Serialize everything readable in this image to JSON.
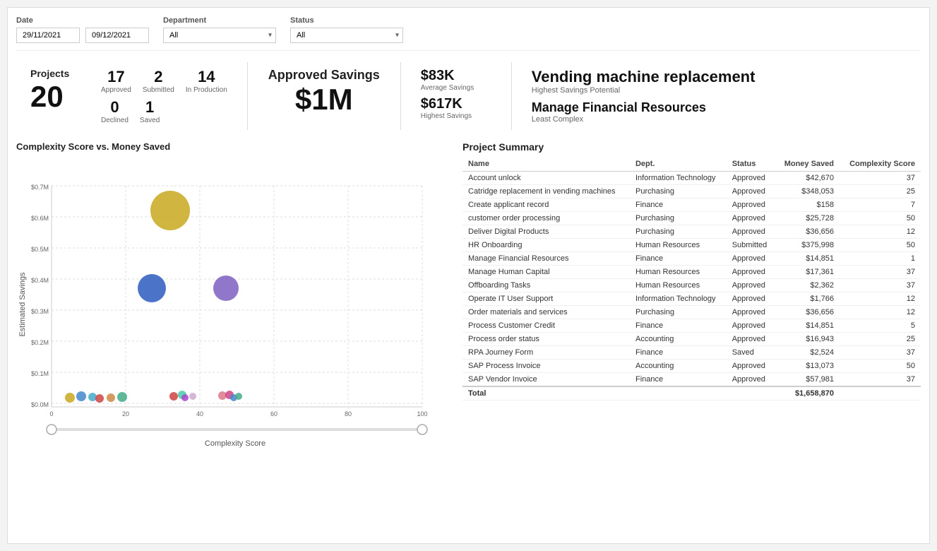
{
  "filters": {
    "date_label": "Date",
    "date_from": "29/11/2021",
    "date_to": "09/12/2021",
    "department_label": "Department",
    "department_value": "All",
    "status_label": "Status",
    "status_value": "All"
  },
  "kpi": {
    "projects_label": "Projects",
    "projects_total": "20",
    "approved_num": "17",
    "approved_label": "Approved",
    "submitted_num": "2",
    "submitted_label": "Submitted",
    "in_production_num": "14",
    "in_production_label": "In Production",
    "declined_num": "0",
    "declined_label": "Declined",
    "saved_num": "1",
    "saved_label": "Saved",
    "approved_savings_label": "Approved Savings",
    "approved_savings_amount": "$1M",
    "avg_savings_value": "$83K",
    "avg_savings_label": "Average Savings",
    "highest_savings_value": "$617K",
    "highest_savings_label": "Highest Savings",
    "vending_title": "Vending machine replacement",
    "vending_sub": "Highest Savings Potential",
    "finance_title": "Manage Financial Resources",
    "finance_sub": "Least Complex"
  },
  "chart": {
    "title": "Complexity Score vs. Money Saved",
    "x_label": "Complexity Score",
    "y_label": "Estimated Savings",
    "bubbles": [
      {
        "x": 32,
        "y": 0.62,
        "r": 28,
        "color": "#c8a820"
      },
      {
        "x": 27,
        "y": 0.37,
        "r": 20,
        "color": "#2b5cbf"
      },
      {
        "x": 47,
        "y": 0.37,
        "r": 18,
        "color": "#7e5fbf"
      },
      {
        "x": 5,
        "y": 0.01,
        "r": 8,
        "color": "#c8a820"
      },
      {
        "x": 8,
        "y": 0.01,
        "r": 8,
        "color": "#4488cc"
      },
      {
        "x": 11,
        "y": 0.01,
        "r": 7,
        "color": "#44aacc"
      },
      {
        "x": 13,
        "y": 0.01,
        "r": 7,
        "color": "#cc4444"
      },
      {
        "x": 16,
        "y": 0.01,
        "r": 6,
        "color": "#cc8844"
      },
      {
        "x": 19,
        "y": 0.01,
        "r": 7,
        "color": "#44aa88"
      },
      {
        "x": 33,
        "y": 0.01,
        "r": 6,
        "color": "#cc4444"
      },
      {
        "x": 35,
        "y": 0.01,
        "r": 5,
        "color": "#aa44cc"
      },
      {
        "x": 36,
        "y": 0.02,
        "r": 7,
        "color": "#44ccaa"
      },
      {
        "x": 38,
        "y": 0.01,
        "r": 5,
        "color": "#ccaacc"
      },
      {
        "x": 46,
        "y": 0.015,
        "r": 6,
        "color": "#dd7788"
      },
      {
        "x": 48,
        "y": 0.02,
        "r": 6,
        "color": "#cc4488"
      }
    ],
    "y_ticks": [
      "$0.0M",
      "$0.1M",
      "$0.2M",
      "$0.3M",
      "$0.4M",
      "$0.5M",
      "$0.6M",
      "$0.7M"
    ],
    "x_ticks": [
      "0",
      "20",
      "40",
      "60",
      "80",
      "100"
    ]
  },
  "table": {
    "title": "Project Summary",
    "headers": [
      "Name",
      "Dept.",
      "Status",
      "Money Saved",
      "Complexity Score"
    ],
    "rows": [
      [
        "Account unlock",
        "Information Technology",
        "Approved",
        "$42,670",
        "37"
      ],
      [
        "Catridge replacement in vending machines",
        "Purchasing",
        "Approved",
        "$348,053",
        "25"
      ],
      [
        "Create applicant record",
        "Finance",
        "Approved",
        "$158",
        "7"
      ],
      [
        "customer order processing",
        "Purchasing",
        "Approved",
        "$25,728",
        "50"
      ],
      [
        "Deliver Digital Products",
        "Purchasing",
        "Approved",
        "$36,656",
        "12"
      ],
      [
        "HR Onboarding",
        "Human Resources",
        "Submitted",
        "$375,998",
        "50"
      ],
      [
        "Manage Financial Resources",
        "Finance",
        "Approved",
        "$14,851",
        "1"
      ],
      [
        "Manage Human Capital",
        "Human Resources",
        "Approved",
        "$17,361",
        "37"
      ],
      [
        "Offboarding Tasks",
        "Human Resources",
        "Approved",
        "$2,362",
        "37"
      ],
      [
        "Operate IT User Support",
        "Information Technology",
        "Approved",
        "$1,766",
        "12"
      ],
      [
        "Order materials and services",
        "Purchasing",
        "Approved",
        "$36,656",
        "12"
      ],
      [
        "Process Customer Credit",
        "Finance",
        "Approved",
        "$14,851",
        "5"
      ],
      [
        "Process order status",
        "Accounting",
        "Approved",
        "$16,943",
        "25"
      ],
      [
        "RPA Journey Form",
        "Finance",
        "Saved",
        "$2,524",
        "37"
      ],
      [
        "SAP Process Invoice",
        "Accounting",
        "Approved",
        "$13,073",
        "50"
      ],
      [
        "SAP Vendor Invoice",
        "Finance",
        "Approved",
        "$57,981",
        "37"
      ]
    ],
    "total_label": "Total",
    "total_money": "$1,658,870"
  }
}
